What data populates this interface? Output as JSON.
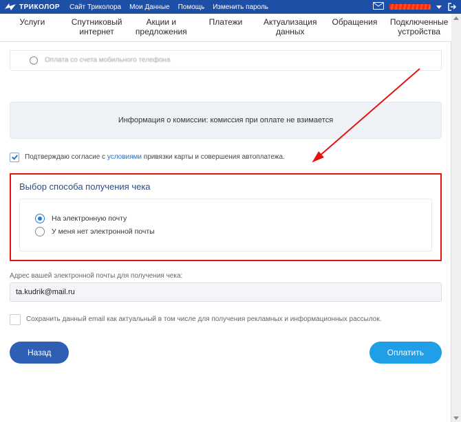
{
  "header": {
    "brand": "ТРИКОЛОР",
    "links": [
      "Сайт Триколора",
      "Мои Данные",
      "Помощь",
      "Изменить пароль"
    ]
  },
  "nav": {
    "tabs": [
      "Услуги",
      "Спутниковый интернет",
      "Акции и предложения",
      "Платежи",
      "Актуализация данных",
      "Обращения",
      "Подключенные устройства"
    ]
  },
  "truncated_option": "Оплата со счета мобильного телефона",
  "commission_info": "Информация о комиссии: комиссия при оплате не взимается",
  "agree": {
    "pre": "Подтверждаю согласие с ",
    "link": "условиями",
    "post": " привязки карты и совершения автоплатежа."
  },
  "receipt": {
    "title": "Выбор способа получения чека",
    "options": [
      "На электронную почту",
      "У меня нет электронной почты"
    ]
  },
  "email": {
    "label": "Адрес вашей электронной почты для получения чека:",
    "value": "ta.kudrik@mail.ru"
  },
  "save_email_label": "Сохранить данный email как актуальный в том числе для получения рекламных и информационных рассылок.",
  "buttons": {
    "back": "Назад",
    "pay": "Оплатить"
  }
}
